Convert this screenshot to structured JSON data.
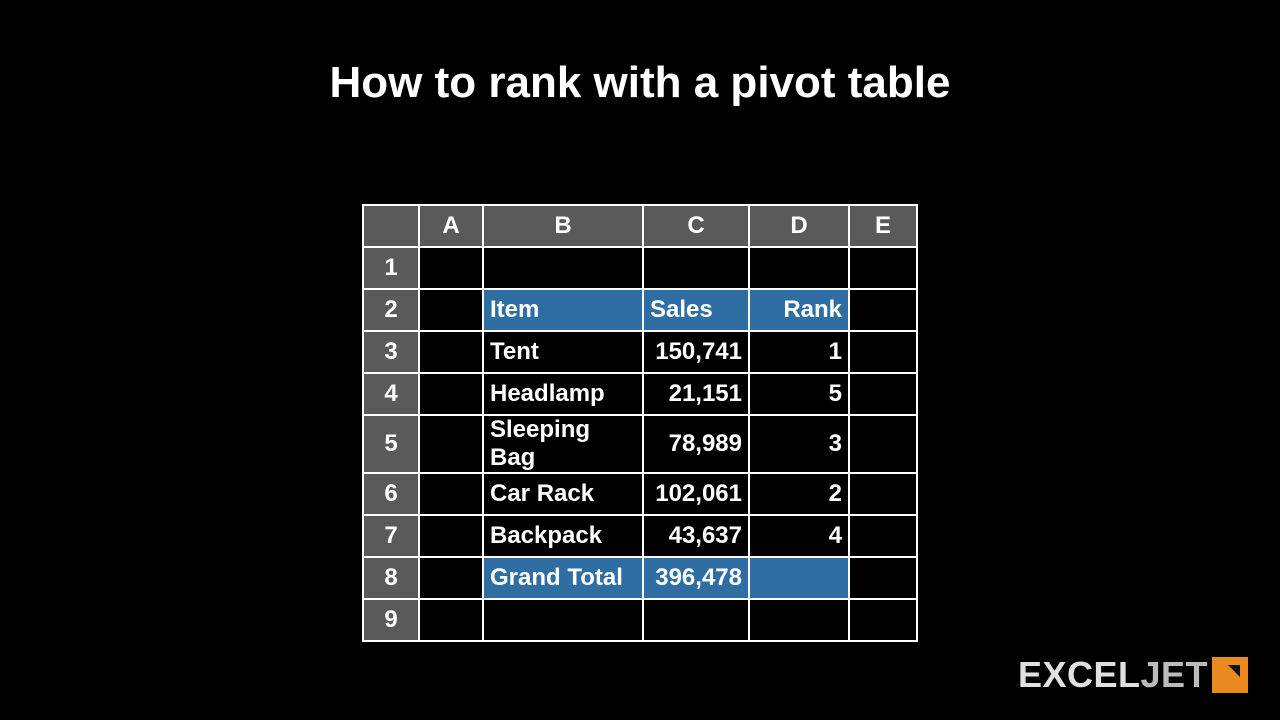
{
  "title": "How to rank with a pivot table",
  "columns": {
    "corner": "",
    "A": "A",
    "B": "B",
    "C": "C",
    "D": "D",
    "E": "E"
  },
  "rownums": {
    "r1": "1",
    "r2": "2",
    "r3": "3",
    "r4": "4",
    "r5": "5",
    "r6": "6",
    "r7": "7",
    "r8": "8",
    "r9": "9"
  },
  "headers": {
    "item": "Item",
    "sales": "Sales",
    "rank": "Rank"
  },
  "rows": [
    {
      "item": "Tent",
      "sales": "150,741",
      "rank": "1"
    },
    {
      "item": "Headlamp",
      "sales": "21,151",
      "rank": "5"
    },
    {
      "item": "Sleeping Bag",
      "sales": "78,989",
      "rank": "3"
    },
    {
      "item": "Car Rack",
      "sales": "102,061",
      "rank": "2"
    },
    {
      "item": "Backpack",
      "sales": "43,637",
      "rank": "4"
    }
  ],
  "total": {
    "label": "Grand Total",
    "sales": "396,478"
  },
  "brand": {
    "text1": "EXCEL",
    "text2": "JET"
  }
}
